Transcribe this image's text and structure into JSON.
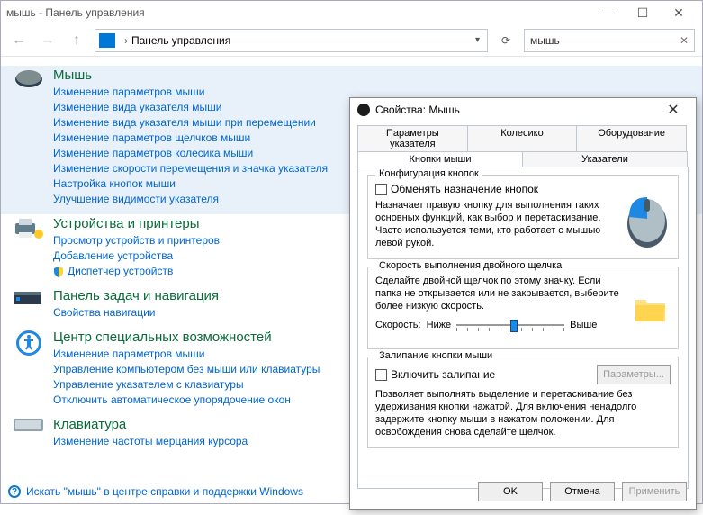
{
  "window": {
    "title": "мышь - Панель управления",
    "breadcrumb": "Панель управления",
    "search_value": "мышь"
  },
  "categories": [
    {
      "title": "Мышь",
      "links": [
        "Изменение параметров мыши",
        "Изменение вида указателя мыши",
        "Изменение вида указателя мыши при перемещении",
        "Изменение параметров щелчков мыши",
        "Изменение параметров колесика мыши",
        "Изменение скорости перемещения и значка указателя",
        "Настройка кнопок мыши",
        "Улучшение видимости указателя"
      ]
    },
    {
      "title": "Устройства и принтеры",
      "links": [
        "Просмотр устройств и принтеров",
        "Добавление устройства",
        "Диспетчер устройств"
      ],
      "shield_on": 2
    },
    {
      "title": "Панель задач и навигация",
      "links": [
        "Свойства навигации"
      ]
    },
    {
      "title": "Центр специальных возможностей",
      "links": [
        "Изменение параметров мыши",
        "Управление компьютером без мыши или клавиатуры",
        "Управление указателем с клавиатуры",
        "Отключить автоматическое упорядочение окон"
      ]
    },
    {
      "title": "Клавиатура",
      "links": [
        "Изменение частоты мерцания курсора"
      ]
    }
  ],
  "footer_help": "Искать \"мышь\" в центре справки и поддержки Windows",
  "dialog": {
    "title": "Свойства: Мышь",
    "tabs_row1": [
      "Параметры указателя",
      "Колесико",
      "Оборудование"
    ],
    "tabs_row2": [
      "Кнопки мыши",
      "Указатели"
    ],
    "active_tab": "Кнопки мыши",
    "group_buttons": {
      "title": "Конфигурация кнопок",
      "checkbox": "Обменять назначение кнопок",
      "desc": "Назначает правую кнопку для выполнения таких основных функций, как выбор и перетаскивание. Часто используется теми, кто работает с мышью левой рукой."
    },
    "group_dblclick": {
      "title": "Скорость выполнения двойного щелчка",
      "desc": "Сделайте двойной щелчок по этому значку. Если папка не открывается или не закрывается, выберите более низкую скорость.",
      "speed_label": "Скорость:",
      "slow": "Ниже",
      "fast": "Выше"
    },
    "group_clicklock": {
      "title": "Залипание кнопки мыши",
      "checkbox": "Включить залипание",
      "params_btn": "Параметры...",
      "desc": "Позволяет выполнять выделение и перетаскивание без удерживания кнопки нажатой. Для включения ненадолго задержите кнопку мыши в нажатом положении. Для освобождения снова сделайте щелчок."
    },
    "buttons": {
      "ok": "OK",
      "cancel": "Отмена",
      "apply": "Применить"
    }
  }
}
